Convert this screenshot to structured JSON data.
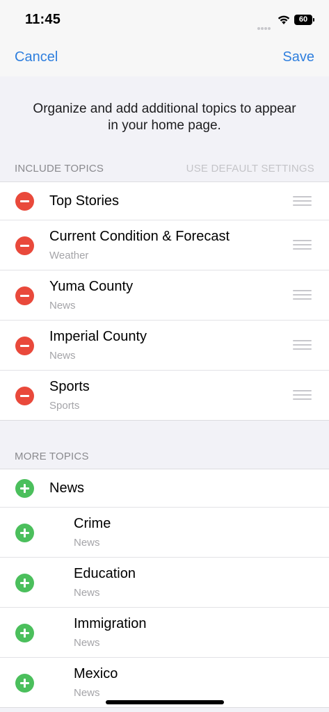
{
  "status": {
    "time": "11:45",
    "battery": "60",
    "battery_level": 0.6
  },
  "nav": {
    "cancel_label": "Cancel",
    "save_label": "Save"
  },
  "intro": "Organize and add additional topics to appear in your home page.",
  "include_section": {
    "header": "INCLUDE TOPICS",
    "action": "USE DEFAULT SETTINGS",
    "items": [
      {
        "title": "Top Stories",
        "subtitle": ""
      },
      {
        "title": "Current Condition & Forecast",
        "subtitle": "Weather"
      },
      {
        "title": "Yuma County",
        "subtitle": "News"
      },
      {
        "title": "Imperial County",
        "subtitle": "News"
      },
      {
        "title": "Sports",
        "subtitle": "Sports"
      }
    ]
  },
  "more_section": {
    "header": "MORE TOPICS",
    "items": [
      {
        "title": "News",
        "subtitle": ""
      },
      {
        "title": "Crime",
        "subtitle": "News"
      },
      {
        "title": "Education",
        "subtitle": "News"
      },
      {
        "title": "Immigration",
        "subtitle": "News"
      },
      {
        "title": "Mexico",
        "subtitle": "News"
      }
    ]
  },
  "colors": {
    "accent": "#2f7fde",
    "remove": "#e9493b",
    "add": "#4bbf5c",
    "background": "#f2f2f7"
  }
}
